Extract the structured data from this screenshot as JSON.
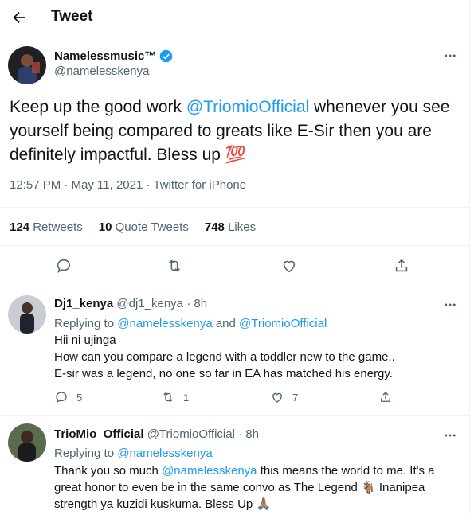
{
  "header": {
    "title": "Tweet",
    "back_icon": "arrow-left-icon"
  },
  "tweet": {
    "author_name": "Namelessmusic™",
    "author_handle": "@namelesskenya",
    "verified_icon": "verified-badge-icon",
    "text_before": "Keep up the good work ",
    "mention": "@TriomioOfficial",
    "text_after": " whenever you see yourself being compared to greats like E-Sir then you are definitely impactful. Bless up ",
    "emoji": "💯",
    "meta": "12:57 PM · May 11, 2021 · Twitter for iPhone",
    "stats": {
      "retweets_count": "124",
      "retweets_label": "Retweets",
      "quotes_count": "10",
      "quotes_label": "Quote Tweets",
      "likes_count": "748",
      "likes_label": "Likes"
    }
  },
  "replies": [
    {
      "name": "Dj1_kenya",
      "handle": "@dj1_kenya",
      "time": "· 8h",
      "replying_prefix": "Replying to ",
      "replying_1": "@namelesskenya",
      "replying_and": " and ",
      "replying_2": "@TriomioOfficial",
      "line1": "Hii ni ujinga",
      "line2": "How can you compare a legend with a toddler new to the game..",
      "line3": "E-sir was a legend, no one so far in EA has matched his energy.",
      "reply_count": "5",
      "retweet_count": "1",
      "like_count": "7"
    },
    {
      "name": "TrioMio_Official",
      "handle": "@TriomioOfficial",
      "time": "· 8h",
      "replying_prefix": "Replying to ",
      "replying_1": "@namelesskenya",
      "line1_before": "Thank you so much ",
      "line1_mention": "@namelesskenya",
      "line1_after": " this means the world to me. It's a",
      "line2": "great honor to even be in the same convo as The Legend 🐐 Inanipea",
      "line3": "strength ya kuzidi kuskuma. Bless Up 🙏🏽"
    }
  ],
  "colors": {
    "accent": "#1d9bf0",
    "muted": "#536471",
    "text": "#0f1419",
    "emoji_red": "#e0245e"
  }
}
